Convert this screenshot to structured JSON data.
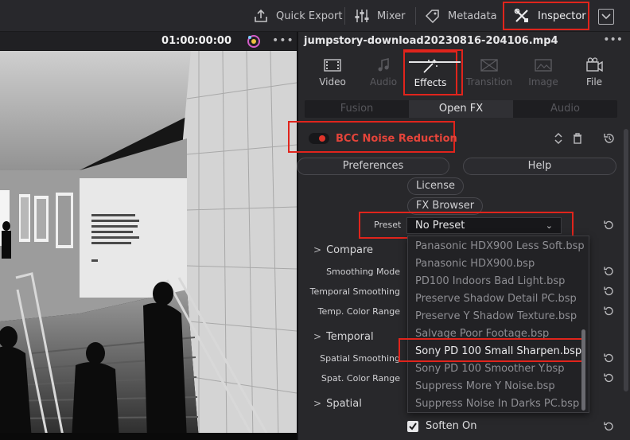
{
  "topbar": {
    "quick_export": "Quick Export",
    "mixer": "Mixer",
    "metadata": "Metadata",
    "inspector": "Inspector"
  },
  "viewer": {
    "timecode": "01:00:00:00",
    "more": "•••"
  },
  "inspector": {
    "clip_name": "jumpstory-download20230816-204106.mp4",
    "more": "•••",
    "tabs": [
      {
        "label": "Video",
        "enabled": true
      },
      {
        "label": "Audio",
        "enabled": false
      },
      {
        "label": "Effects",
        "enabled": true,
        "active": true
      },
      {
        "label": "Transition",
        "enabled": false
      },
      {
        "label": "Image",
        "enabled": false
      },
      {
        "label": "File",
        "enabled": true
      }
    ],
    "subtabs": [
      "Fusion",
      "Open FX",
      "Audio"
    ],
    "active_subtab": "Open FX",
    "effect": {
      "name": "BCC Noise Reduction",
      "enabled": true,
      "buttons": {
        "preferences": "Preferences",
        "help": "Help",
        "license": "License",
        "fx_browser": "FX Browser"
      },
      "preset_label": "Preset",
      "preset_value": "No Preset",
      "groups": {
        "compare": "Compare",
        "temporal": "Temporal",
        "spatial": "Spatial"
      },
      "params": {
        "smoothing_mode": "Smoothing Mode",
        "temporal_smoothing": "Temporal Smoothing",
        "temp_color_range": "Temp. Color Range",
        "spatial_smoothing": "Spatial Smoothing",
        "spat_color_range": "Spat. Color Range"
      },
      "soften_on": {
        "label": "Soften On",
        "checked": true
      }
    },
    "preset_options": [
      "Panasonic HDX900 Less Soft.bsp",
      "Panasonic HDX900.bsp",
      "PD100 Indoors Bad Light.bsp",
      "Preserve Shadow Detail PC.bsp",
      "Preserve Y Shadow Texture.bsp",
      "Salvage Poor Footage.bsp",
      "Sony PD 100 Small Sharpen.bsp",
      "Sony PD 100 Smoother Y.bsp",
      "Suppress More Y Noise.bsp",
      "Suppress Noise In Darks PC.bsp"
    ],
    "highlighted_option": "Sony PD 100 Small Sharpen.bsp"
  },
  "colors": {
    "accent_red": "#e0241c",
    "effect_name_red": "#e5443a",
    "panel_bg": "#28282b"
  }
}
